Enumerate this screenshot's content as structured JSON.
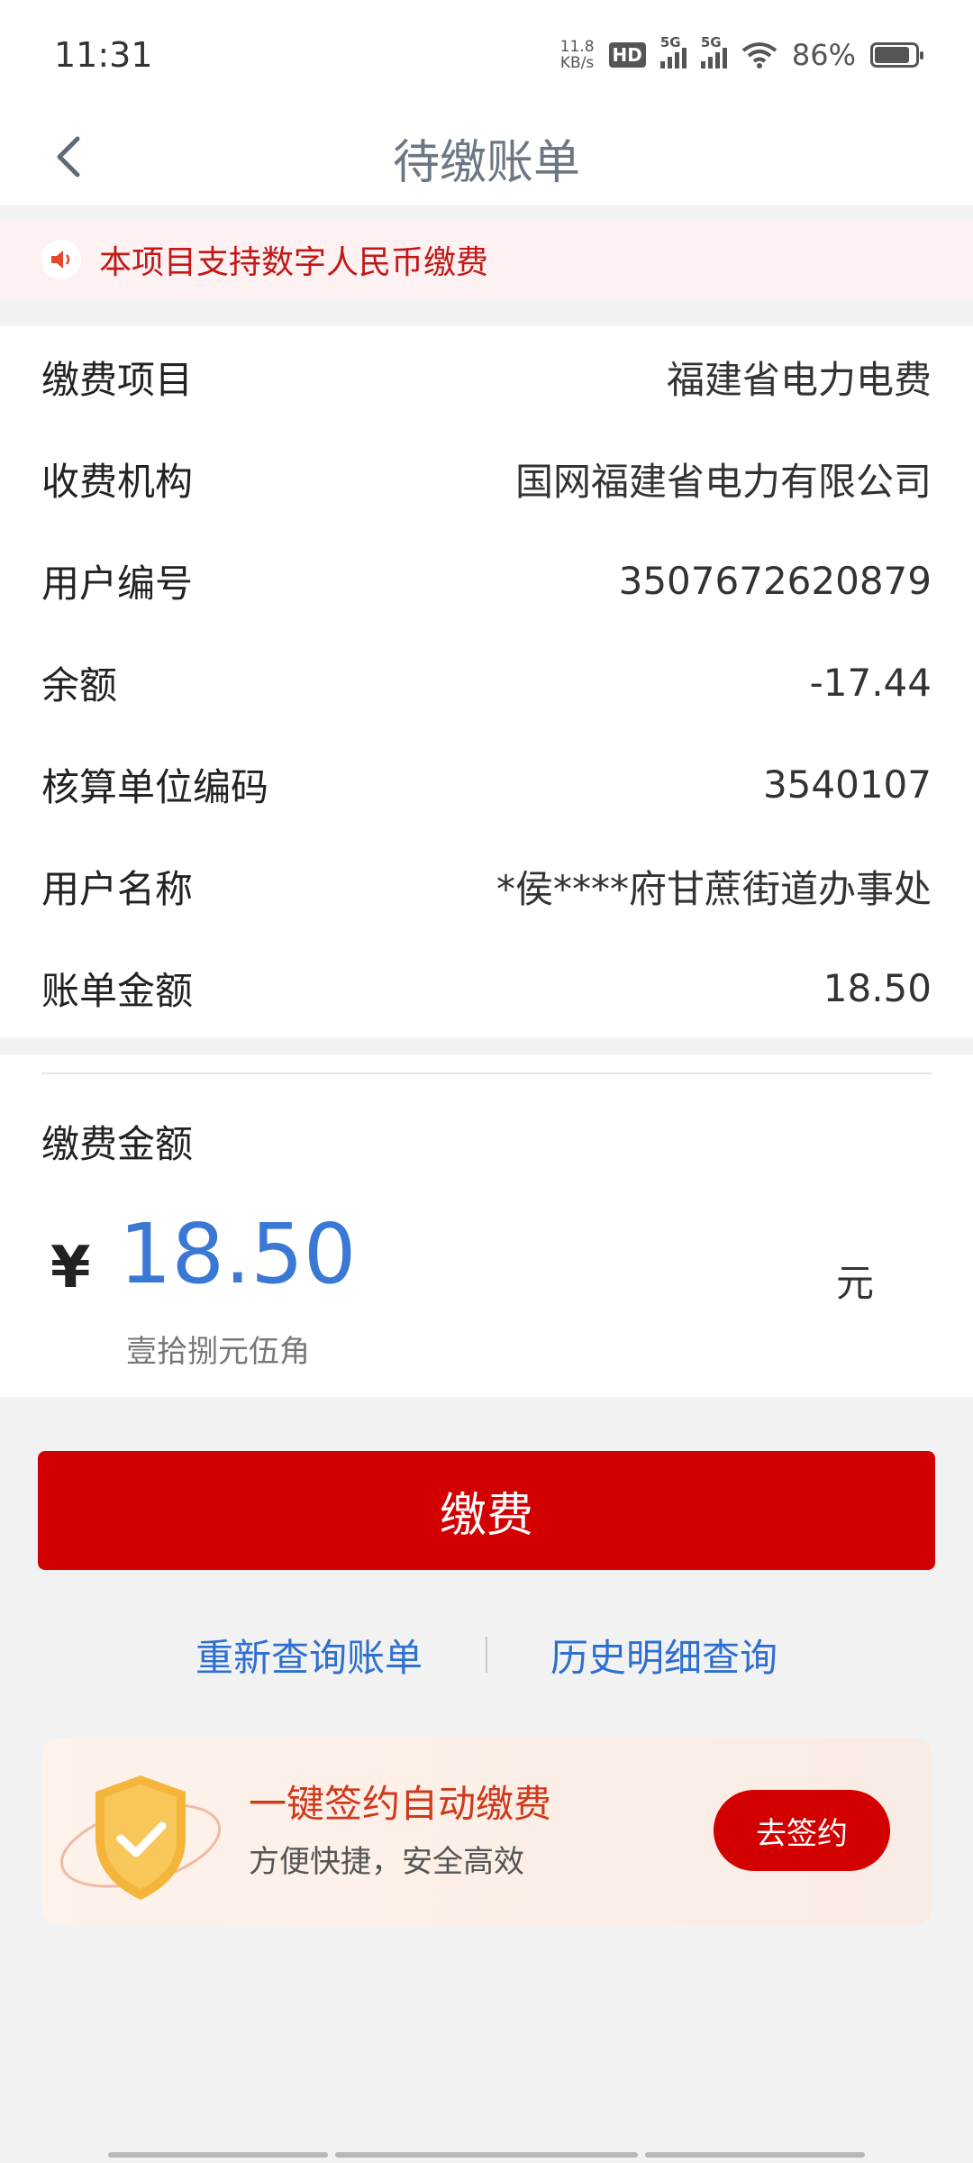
{
  "status_bar": {
    "time": "11:31",
    "net_speed_value": "11.8",
    "net_speed_unit": "KB/s",
    "hd_badge": "HD",
    "sim1_label": "5G",
    "sim2_label": "5G",
    "battery": "86%",
    "battery_level": 0.86
  },
  "nav": {
    "title": "待缴账单",
    "back_icon": "chevron-left-icon"
  },
  "notice": {
    "icon": "speaker-icon",
    "text": "本项目支持数字人民币缴费"
  },
  "bill_info": [
    {
      "label": "缴费项目",
      "value": "福建省电力电费"
    },
    {
      "label": "收费机构",
      "value": "国网福建省电力有限公司"
    },
    {
      "label": "用户编号",
      "value": "3507672620879"
    },
    {
      "label": "余额",
      "value": "-17.44"
    },
    {
      "label": "核算单位编码",
      "value": "3540107"
    },
    {
      "label": "用户名称",
      "value": "*侯****府甘蔗街道办事处"
    },
    {
      "label": "账单金额",
      "value": "18.50"
    }
  ],
  "payment": {
    "label": "缴费金额",
    "currency_symbol": "¥",
    "amount": "18.50",
    "unit": "元",
    "amount_in_words": "壹拾捌元伍角"
  },
  "pay_button": "缴费",
  "links": {
    "requery": "重新查询账单",
    "history": "历史明细查询"
  },
  "promo": {
    "title": "一键签约自动缴费",
    "subtitle": "方便快捷，安全高效",
    "button": "去签约",
    "icon": "shield-check-icon"
  },
  "colors": {
    "primary_red": "#d20000",
    "link_blue": "#2f6fd0",
    "amount_blue": "#3a78d6",
    "notice_bg": "#fdf1f1"
  }
}
